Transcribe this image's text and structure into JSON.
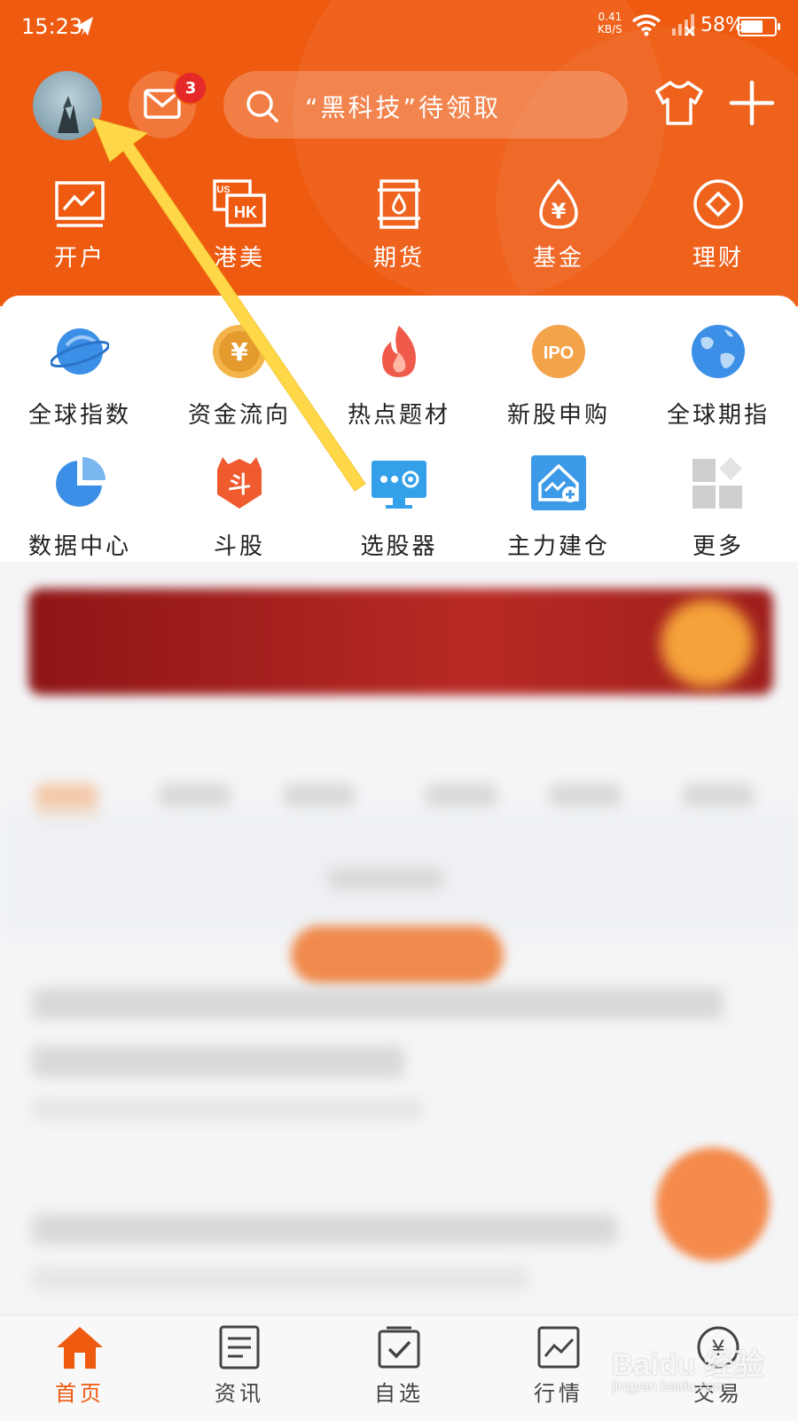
{
  "status_bar": {
    "time": "15:23",
    "net_speed": "0.41",
    "net_unit": "KB/S",
    "battery": "58%"
  },
  "header": {
    "message_badge": "3",
    "search_placeholder": "“黑科技”待领取"
  },
  "top_nav": [
    "开户",
    "港美",
    "期货",
    "基金",
    "理财"
  ],
  "feature_grid": {
    "row1": [
      "全球指数",
      "资金流向",
      "热点题材",
      "新股申购",
      "全球期指"
    ],
    "row2": [
      "数据中心",
      "斗股",
      "选股器",
      "主力建仓",
      "更多"
    ]
  },
  "icon_text": {
    "hk": "HK",
    "us": "US",
    "yen": "¥",
    "ipo": "IPO",
    "dou": "斗"
  },
  "tab_bar": [
    "首页",
    "资讯",
    "自选",
    "行情",
    "交易"
  ],
  "watermark": {
    "brand": "Baidu 经验",
    "url": "jingyan.baidu.com"
  },
  "colors": {
    "brand_orange": "#ee5a10",
    "arrow_yellow": "#ffd84a",
    "badge_red": "#e52828"
  }
}
